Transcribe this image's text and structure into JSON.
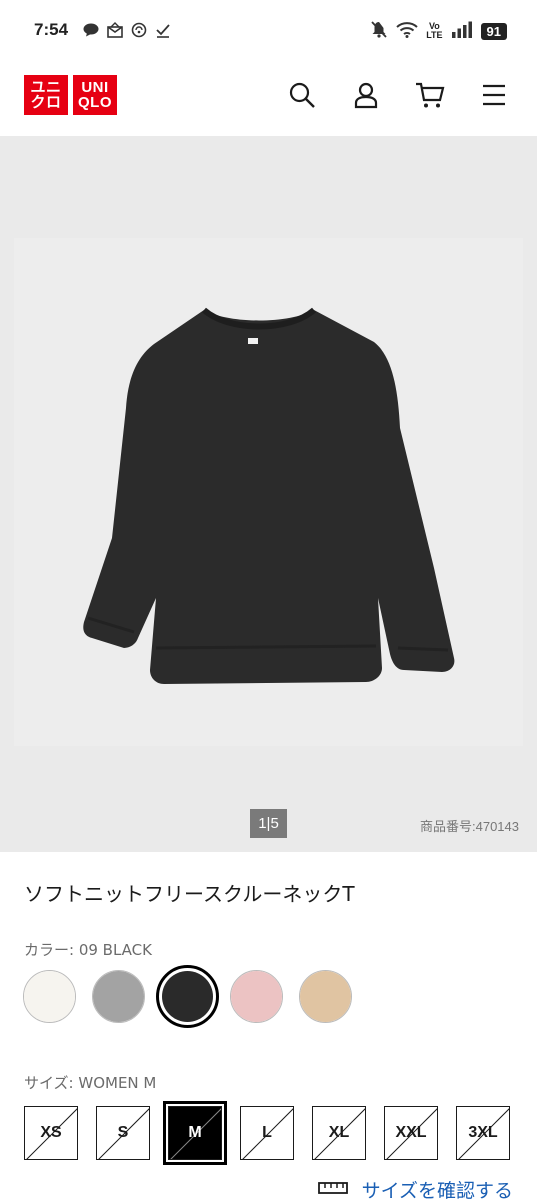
{
  "status_bar": {
    "time": "7:54",
    "battery": "91",
    "volte_top": "Vo",
    "volte_bottom": "LTE",
    "left_icons": [
      "line-icon",
      "mail-icon",
      "sync-icon",
      "check-icon"
    ],
    "right_icons": [
      "mute-icon",
      "wifi-icon",
      "volte-icon",
      "signal-icon",
      "battery-icon"
    ]
  },
  "header": {
    "logo_top_left": "ユニ",
    "logo_bottom_left": "クロ",
    "logo_top_right": "UNI",
    "logo_bottom_right": "QLO",
    "icons": [
      "search-icon",
      "account-icon",
      "cart-icon",
      "menu-icon"
    ]
  },
  "gallery": {
    "pager": "1|5",
    "product_code": "商品番号:470143"
  },
  "product": {
    "title": "ソフトニットフリースクルーネックT",
    "color_label": "カラー: 09 BLACK",
    "colors": [
      {
        "name": "white",
        "hex": "#f6f4ef"
      },
      {
        "name": "gray",
        "hex": "#a3a3a3"
      },
      {
        "name": "black",
        "hex": "#2a2a2a"
      },
      {
        "name": "pink",
        "hex": "#ecc3c3"
      },
      {
        "name": "beige",
        "hex": "#e0c4a2"
      }
    ],
    "selected_color_index": 2,
    "size_label": "サイズ: WOMEN M",
    "sizes": [
      "XS",
      "S",
      "M",
      "L",
      "XL",
      "XXL",
      "3XL"
    ],
    "selected_size_index": 2,
    "size_guide": "サイズを確認する"
  }
}
